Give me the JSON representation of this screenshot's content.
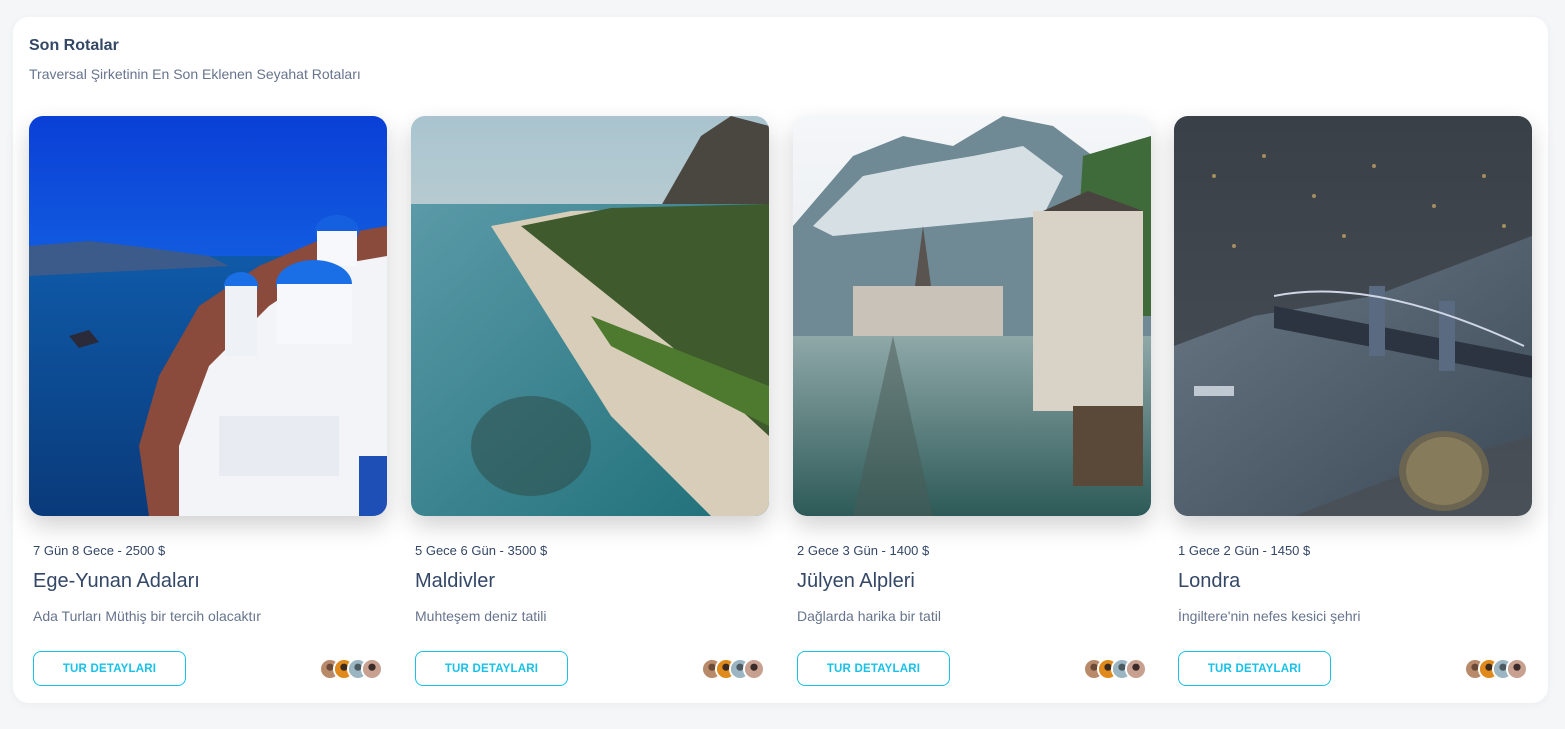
{
  "section": {
    "title": "Son Rotalar",
    "subtitle": "Traversal Şirketinin En Son Eklenen Seyahat Rotaları"
  },
  "cards": [
    {
      "meta": "7 Gün 8 Gece - 2500 $",
      "title": "Ege-Yunan Adaları",
      "description": "Ada Turları Müthiş bir tercih olacaktır",
      "button_label": "TUR DETAYLARI",
      "image_icon": "santorini-photo"
    },
    {
      "meta": "5 Gece 6 Gün - 3500 $",
      "title": "Maldivler",
      "description": "Muhteşem deniz tatili",
      "button_label": "TUR DETAYLARI",
      "image_icon": "beach-photo"
    },
    {
      "meta": "2 Gece 3 Gün - 1400 $",
      "title": "Jülyen Alpleri",
      "description": "Dağlarda harika bir tatil",
      "button_label": "TUR DETAYLARI",
      "image_icon": "alps-village-photo"
    },
    {
      "meta": "1 Gece 2 Gün - 1450 $",
      "title": "Londra",
      "description": "İngiltere'nin nefes kesici şehri",
      "button_label": "TUR DETAYLARI",
      "image_icon": "london-night-photo"
    }
  ],
  "colors": {
    "accent": "#17c1e8",
    "heading": "#344767",
    "muted": "#67748e"
  }
}
